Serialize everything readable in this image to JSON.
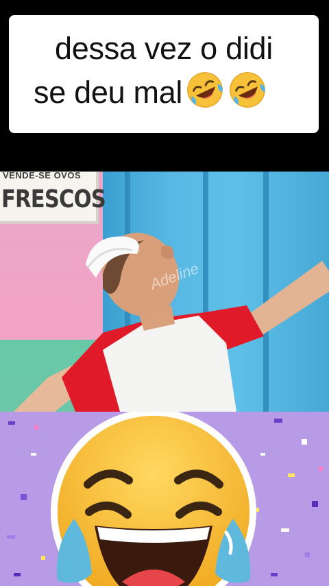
{
  "caption": {
    "line1": "dessa vez o didi",
    "line2": "se deu mal",
    "emojis": [
      "rolling-on-floor-laughing-icon",
      "rolling-on-floor-laughing-icon"
    ]
  },
  "video": {
    "sign_top": "VENDE-SE OVOS",
    "sign_main": "FRESCOS",
    "watermark": "Adeline"
  },
  "sticker": {
    "icon": "face-with-tears-of-joy-icon",
    "background_color": "#b79be6"
  },
  "colors": {
    "caption_bg": "#ffffff",
    "caption_text": "#111111",
    "emoji_yellow": "#f7c23a",
    "tear_blue": "#5fb9dc",
    "shirt_red": "#e11a2a"
  }
}
